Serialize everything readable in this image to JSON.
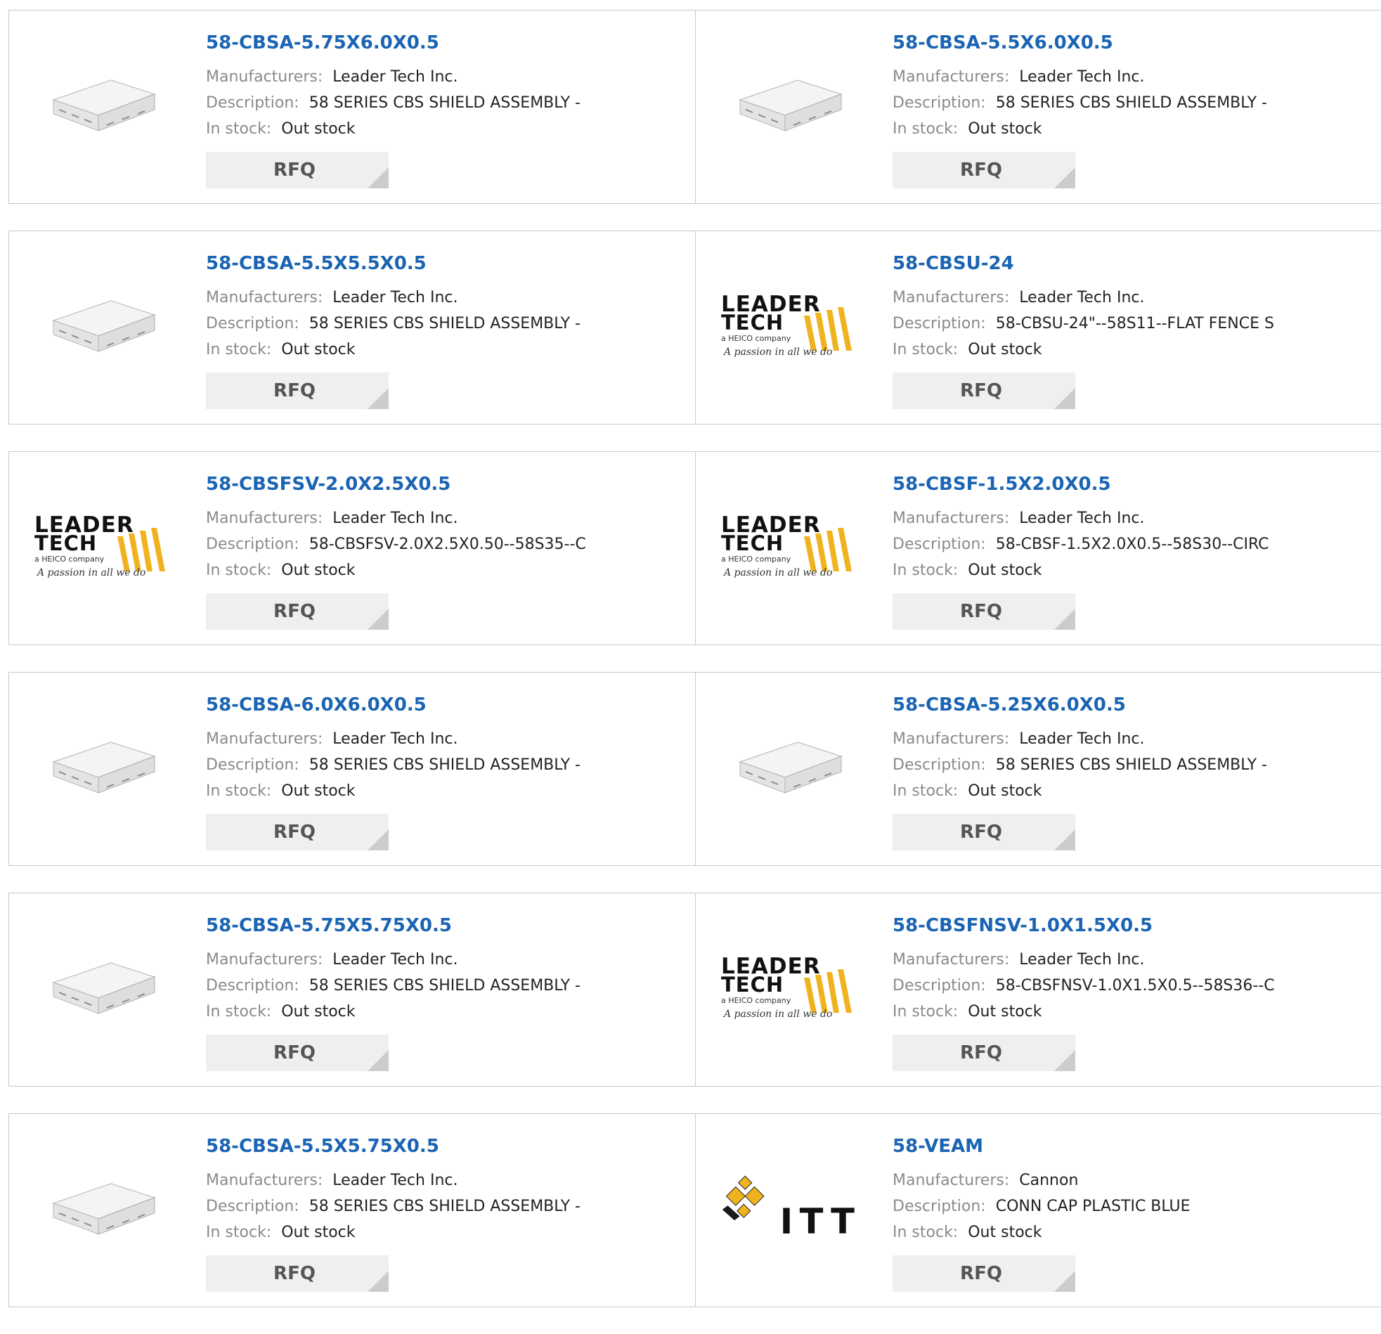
{
  "labels": {
    "manufacturers": "Manufacturers:",
    "description": "Description:",
    "in_stock": "In stock:",
    "rfq": "RFQ"
  },
  "products": [
    {
      "part": "58-CBSA-5.75X6.0X0.5",
      "manufacturer": "Leader Tech Inc.",
      "description": "58 SERIES CBS SHIELD ASSEMBLY -",
      "stock": "Out stock",
      "image": "shield-assembly-photo"
    },
    {
      "part": "58-CBSA-5.5X6.0X0.5",
      "manufacturer": "Leader Tech Inc.",
      "description": "58 SERIES CBS SHIELD ASSEMBLY -",
      "stock": "Out stock",
      "image": "shield-assembly-photo"
    },
    {
      "part": "58-CBSA-5.5X5.5X0.5",
      "manufacturer": "Leader Tech Inc.",
      "description": "58 SERIES CBS SHIELD ASSEMBLY -",
      "stock": "Out stock",
      "image": "shield-assembly-photo"
    },
    {
      "part": "58-CBSU-24",
      "manufacturer": "Leader Tech Inc.",
      "description": "58-CBSU-24\"--58S11--FLAT FENCE S",
      "stock": "Out stock",
      "image": "leader-tech-logo"
    },
    {
      "part": "58-CBSFSV-2.0X2.5X0.5",
      "manufacturer": "Leader Tech Inc.",
      "description": "58-CBSFSV-2.0X2.5X0.50--58S35--C",
      "stock": "Out stock",
      "image": "leader-tech-logo"
    },
    {
      "part": "58-CBSF-1.5X2.0X0.5",
      "manufacturer": "Leader Tech Inc.",
      "description": "58-CBSF-1.5X2.0X0.5--58S30--CIRC",
      "stock": "Out stock",
      "image": "leader-tech-logo"
    },
    {
      "part": "58-CBSA-6.0X6.0X0.5",
      "manufacturer": "Leader Tech Inc.",
      "description": "58 SERIES CBS SHIELD ASSEMBLY -",
      "stock": "Out stock",
      "image": "shield-assembly-photo"
    },
    {
      "part": "58-CBSA-5.25X6.0X0.5",
      "manufacturer": "Leader Tech Inc.",
      "description": "58 SERIES CBS SHIELD ASSEMBLY -",
      "stock": "Out stock",
      "image": "shield-assembly-photo"
    },
    {
      "part": "58-CBSA-5.75X5.75X0.5",
      "manufacturer": "Leader Tech Inc.",
      "description": "58 SERIES CBS SHIELD ASSEMBLY -",
      "stock": "Out stock",
      "image": "shield-assembly-photo"
    },
    {
      "part": "58-CBSFNSV-1.0X1.5X0.5",
      "manufacturer": "Leader Tech Inc.",
      "description": "58-CBSFNSV-1.0X1.5X0.5--58S36--C",
      "stock": "Out stock",
      "image": "leader-tech-logo"
    },
    {
      "part": "58-CBSA-5.5X5.75X0.5",
      "manufacturer": "Leader Tech Inc.",
      "description": "58 SERIES CBS SHIELD ASSEMBLY -",
      "stock": "Out stock",
      "image": "shield-assembly-photo"
    },
    {
      "part": "58-VEAM",
      "manufacturer": "Cannon",
      "description": "CONN CAP PLASTIC BLUE",
      "stock": "Out stock",
      "image": "itt-logo"
    }
  ],
  "logos": {
    "leader_tech": {
      "line1": "LEADER",
      "line2": "TECH",
      "tagline": "a HEICO company",
      "slogan": "A passion in all we do"
    },
    "itt": {
      "text": "ITT"
    }
  },
  "colors": {
    "link": "#1a64b3",
    "label": "#8a8a8a",
    "value": "#222222",
    "rfq_bg": "#efefef",
    "border": "#c9c9c9",
    "logo_gold": "#f0b320"
  }
}
